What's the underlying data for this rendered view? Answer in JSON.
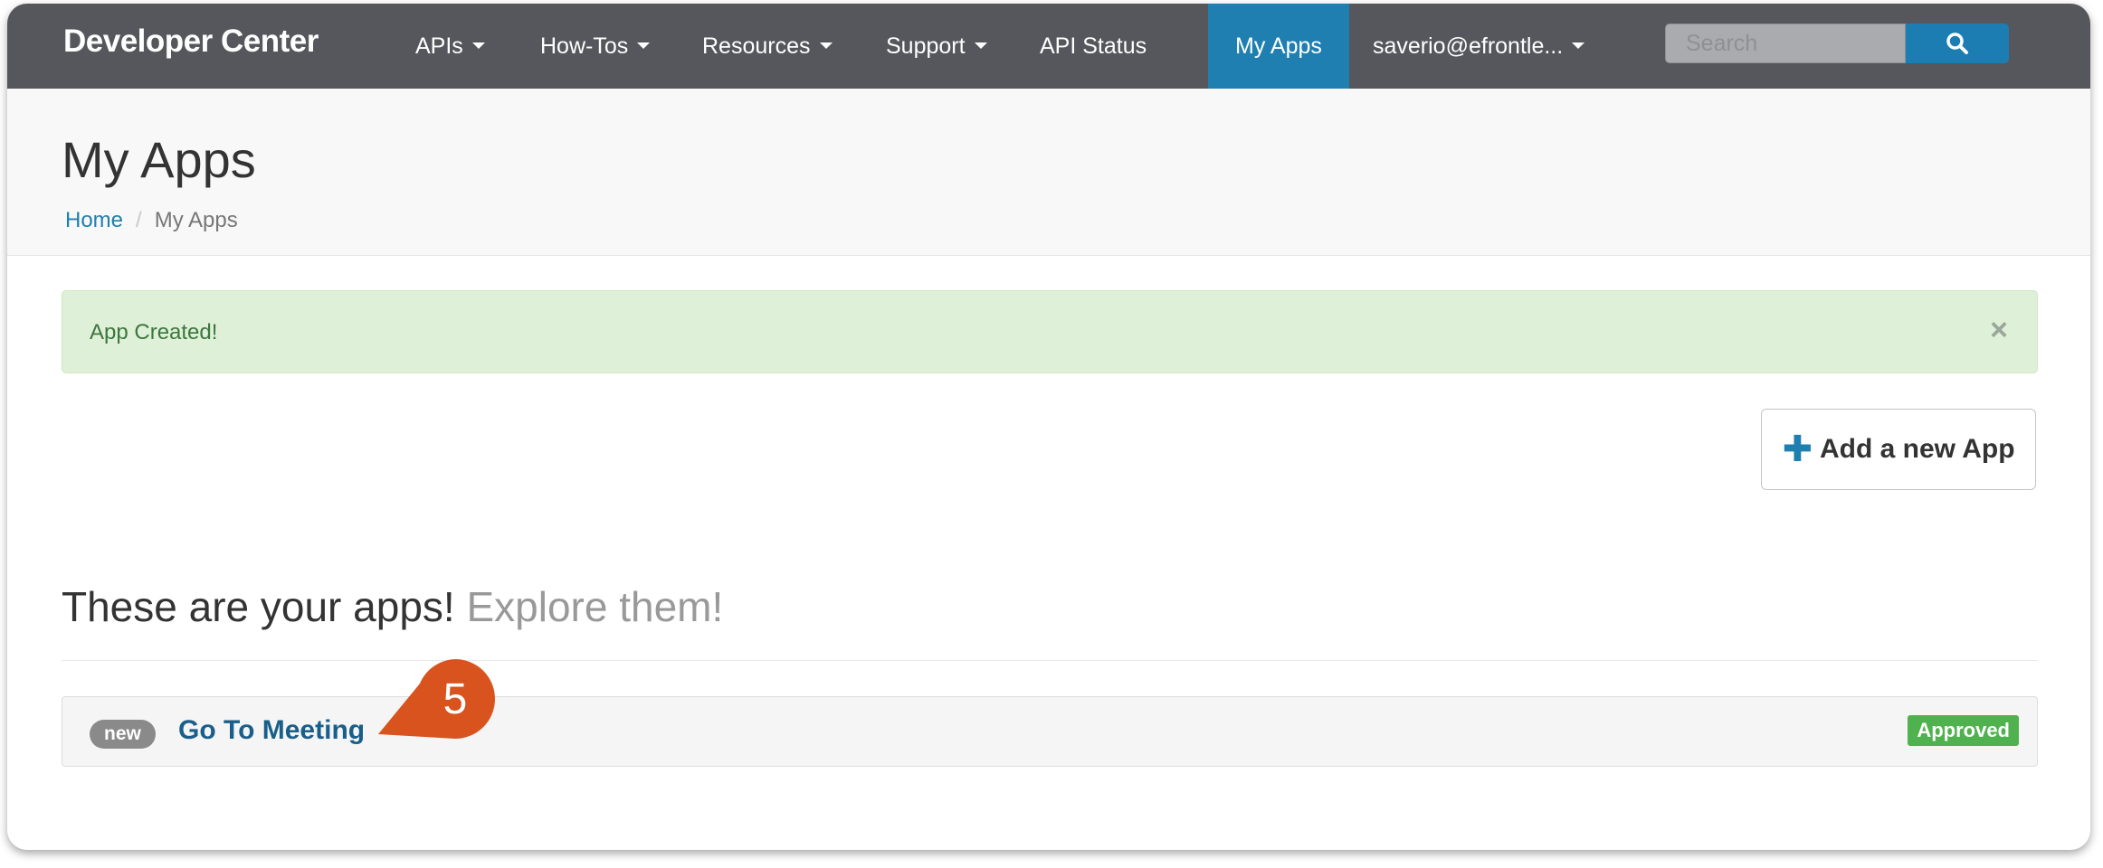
{
  "navbar": {
    "brand": "Developer Center",
    "items": [
      {
        "label": "APIs",
        "dropdown": true
      },
      {
        "label": "How-Tos",
        "dropdown": true
      },
      {
        "label": "Resources",
        "dropdown": true
      },
      {
        "label": "Support",
        "dropdown": true
      },
      {
        "label": "API Status",
        "dropdown": false
      },
      {
        "label": "My Apps",
        "dropdown": false,
        "active": true
      },
      {
        "label": "saverio@efrontle...",
        "dropdown": true
      }
    ],
    "search": {
      "placeholder": "Search",
      "value": ""
    },
    "colors": {
      "background": "#55575c",
      "active": "#1f7fb0"
    }
  },
  "page_header": {
    "title": "My Apps",
    "breadcrumb": {
      "home": "Home",
      "separator": "/",
      "current": "My Apps"
    }
  },
  "alert": {
    "message": "App Created!",
    "close": "×",
    "color": "#dff0d8"
  },
  "actions": {
    "add_app_label": "Add a new App",
    "add_icon": "plus-icon"
  },
  "apps_section": {
    "heading": "These are your apps!",
    "heading_muted": "Explore them!",
    "apps": [
      {
        "badge": "new",
        "name": "Go To Meeting",
        "status": "Approved",
        "status_color": "#4fb24f"
      }
    ]
  },
  "callout": {
    "number": "5",
    "color": "#d9531e"
  }
}
